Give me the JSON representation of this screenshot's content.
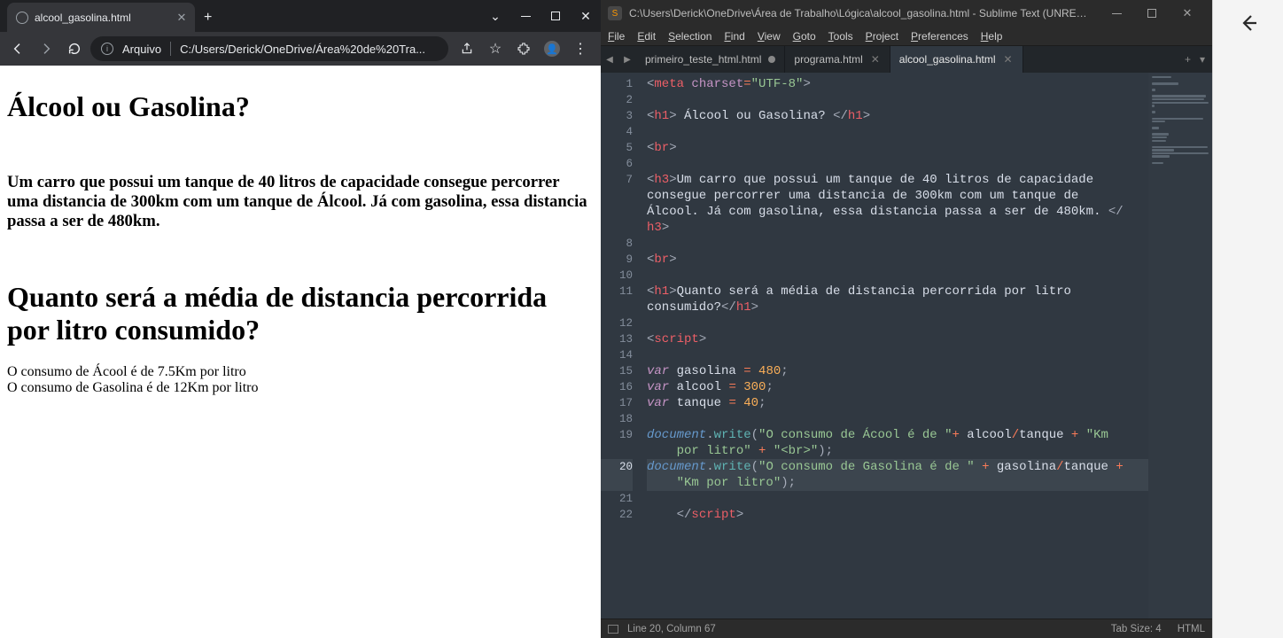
{
  "chrome": {
    "tab_title": "alcool_gasolina.html",
    "url_label": "Arquivo",
    "url": "C:/Users/Derick/OneDrive/Área%20de%20Tra...",
    "page": {
      "h1a": "Álcool ou Gasolina?",
      "h3": "Um carro que possui um tanque de 40 litros de capacidade consegue percorrer uma distancia de 300km com um tanque de Álcool. Já com gasolina, essa distancia passa a ser de 480km.",
      "h1b": "Quanto será a média de distancia percorrida por litro consumido?",
      "line1": "O consumo de Ácool é de 7.5Km por litro",
      "line2": "O consumo de Gasolina é de 12Km por litro"
    }
  },
  "sublime": {
    "title": "C:\\Users\\Derick\\OneDrive\\Área de Trabalho\\Lógica\\alcool_gasolina.html - Sublime Text (UNREGI...",
    "menu": [
      "File",
      "Edit",
      "Selection",
      "Find",
      "View",
      "Goto",
      "Tools",
      "Project",
      "Preferences",
      "Help"
    ],
    "tabs": [
      {
        "label": "primeiro_teste_html.html",
        "state": "dirty"
      },
      {
        "label": "programa.html",
        "state": "close"
      },
      {
        "label": "alcool_gasolina.html",
        "state": "close",
        "active": true
      }
    ],
    "status": {
      "pos": "Line 20, Column 67",
      "indent": "Tab Size: 4",
      "syntax": "HTML"
    },
    "current_line": 20,
    "code": {
      "l1": [
        [
          "<",
          "punc"
        ],
        [
          "meta",
          "tag"
        ],
        [
          " ",
          "text"
        ],
        [
          "charset",
          "attr"
        ],
        [
          "=",
          "op"
        ],
        [
          "\"UTF-8\"",
          "str"
        ],
        [
          ">",
          "punc"
        ]
      ],
      "l2": [],
      "l3": [
        [
          "<",
          "punc"
        ],
        [
          "h1",
          "tag"
        ],
        [
          "> ",
          "punc"
        ],
        [
          "Álcool ou Gasolina? ",
          "text"
        ],
        [
          "</",
          "punc"
        ],
        [
          "h1",
          "tag"
        ],
        [
          ">",
          "punc"
        ]
      ],
      "l4": [],
      "l5": [
        [
          "<",
          "punc"
        ],
        [
          "br",
          "tag"
        ],
        [
          ">",
          "punc"
        ]
      ],
      "l6": [],
      "l7": [
        [
          "<",
          "punc"
        ],
        [
          "h3",
          "tag"
        ],
        [
          ">",
          "punc"
        ],
        [
          "Um carro que possui um tanque de 40 litros de capacidade ",
          "text"
        ]
      ],
      "l7b": [
        [
          "consegue percorrer uma distancia de 300km com um tanque de ",
          "text"
        ]
      ],
      "l7c": [
        [
          "Álcool. Já com gasolina, essa distancia passa a ser de 480km. ",
          "text"
        ],
        [
          "</",
          "punc"
        ]
      ],
      "l7d": [
        [
          "h3",
          "tag"
        ],
        [
          ">",
          "punc"
        ]
      ],
      "l8": [],
      "l9": [
        [
          "<",
          "punc"
        ],
        [
          "br",
          "tag"
        ],
        [
          ">",
          "punc"
        ]
      ],
      "l10": [],
      "l11": [
        [
          "<",
          "punc"
        ],
        [
          "h1",
          "tag"
        ],
        [
          ">",
          "punc"
        ],
        [
          "Quanto será a média de distancia percorrida por litro ",
          "text"
        ]
      ],
      "l11b": [
        [
          "consumido?",
          "text"
        ],
        [
          "</",
          "punc"
        ],
        [
          "h1",
          "tag"
        ],
        [
          ">",
          "punc"
        ]
      ],
      "l12": [],
      "l13": [
        [
          "<",
          "punc"
        ],
        [
          "script",
          "tag"
        ],
        [
          ">",
          "punc"
        ]
      ],
      "l14": [],
      "l15": [
        [
          "var",
          "kw"
        ],
        [
          " gasolina ",
          "var"
        ],
        [
          "=",
          "op"
        ],
        [
          " ",
          "text"
        ],
        [
          "480",
          "num"
        ],
        [
          ";",
          "punc"
        ]
      ],
      "l16": [
        [
          "var",
          "kw"
        ],
        [
          " alcool ",
          "var"
        ],
        [
          "=",
          "op"
        ],
        [
          " ",
          "text"
        ],
        [
          "300",
          "num"
        ],
        [
          ";",
          "punc"
        ]
      ],
      "l17": [
        [
          "var",
          "kw"
        ],
        [
          " tanque ",
          "var"
        ],
        [
          "=",
          "op"
        ],
        [
          " ",
          "text"
        ],
        [
          "40",
          "num"
        ],
        [
          ";",
          "punc"
        ]
      ],
      "l18": [],
      "l19": [
        [
          "document",
          "obj"
        ],
        [
          ".",
          "punc"
        ],
        [
          "write",
          "fn"
        ],
        [
          "(",
          "punc"
        ],
        [
          "\"O consumo de Ácool é de \"",
          "str"
        ],
        [
          "+",
          "op"
        ],
        [
          " alcool",
          "var"
        ],
        [
          "/",
          "op"
        ],
        [
          "tanque ",
          "var"
        ],
        [
          "+",
          "op"
        ],
        [
          " ",
          "text"
        ],
        [
          "\"Km ",
          "str"
        ]
      ],
      "l19b": [
        [
          "    por litro\"",
          "str"
        ],
        [
          " ",
          "text"
        ],
        [
          "+",
          "op"
        ],
        [
          " ",
          "text"
        ],
        [
          "\"<br>\"",
          "str"
        ],
        [
          ")",
          "punc"
        ],
        [
          ";",
          "punc"
        ]
      ],
      "l20": [
        [
          "document",
          "obj"
        ],
        [
          ".",
          "punc"
        ],
        [
          "write",
          "fn"
        ],
        [
          "(",
          "punc"
        ],
        [
          "\"O consumo de Gasolina é de \"",
          "str"
        ],
        [
          " ",
          "text"
        ],
        [
          "+",
          "op"
        ],
        [
          " gasolina",
          "var"
        ],
        [
          "/",
          "op"
        ],
        [
          "tanque ",
          "var"
        ],
        [
          "+",
          "op"
        ],
        [
          " ",
          "text"
        ]
      ],
      "l20b": [
        [
          "    ",
          "text"
        ],
        [
          "\"Km por litro\"",
          "str"
        ],
        [
          ")",
          "punc"
        ],
        [
          ";",
          "punc"
        ]
      ],
      "l21": [],
      "l22": [
        [
          "    ",
          "text"
        ],
        [
          "</",
          "punc"
        ],
        [
          "script",
          "tag"
        ],
        [
          ">",
          "punc"
        ]
      ]
    },
    "line_numbers": [
      1,
      2,
      3,
      4,
      5,
      6,
      7,
      "",
      "",
      "",
      8,
      9,
      10,
      11,
      "",
      12,
      13,
      14,
      15,
      16,
      17,
      18,
      19,
      "",
      20,
      "",
      21,
      22
    ],
    "rows": [
      "l1",
      "l2",
      "l3",
      "l4",
      "l5",
      "l6",
      "l7",
      "l7b",
      "l7c",
      "l7d",
      "l8",
      "l9",
      "l10",
      "l11",
      "l11b",
      "l12",
      "l13",
      "l14",
      "l15",
      "l16",
      "l17",
      "l18",
      "l19",
      "l19b",
      "l20",
      "l20b",
      "l21",
      "l22"
    ],
    "current_row_index": 24
  }
}
